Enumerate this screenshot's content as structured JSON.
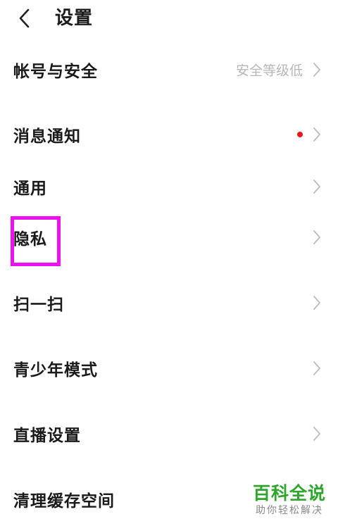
{
  "header": {
    "back_icon": "chevron-left-icon",
    "title": "设置"
  },
  "items": [
    {
      "label": "帐号与安全",
      "note": "安全等级低"
    },
    {
      "label": "消息通知",
      "badge_color": "#e8191c"
    },
    {
      "label": "通用"
    },
    {
      "label": "隐私",
      "highlight_color": "#ee10ee"
    },
    {
      "label": "扫一扫"
    },
    {
      "label": "青少年模式"
    },
    {
      "label": "直播设置"
    },
    {
      "label": "清理缓存空间"
    }
  ],
  "watermark": {
    "title": "百科全说",
    "subtitle": "助你轻松解决"
  }
}
